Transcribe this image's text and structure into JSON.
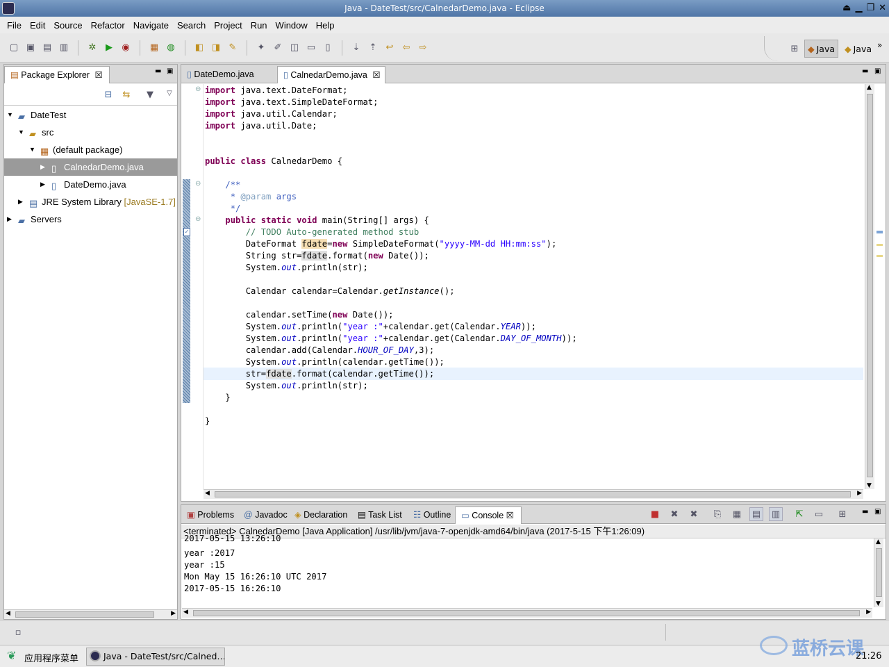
{
  "window": {
    "title": "Java - DateTest/src/CalnedarDemo.java - Eclipse"
  },
  "menu": [
    "File",
    "Edit",
    "Source",
    "Refactor",
    "Navigate",
    "Search",
    "Project",
    "Run",
    "Window",
    "Help"
  ],
  "perspectives": {
    "first": "Java",
    "second": "Java"
  },
  "explorer": {
    "tab_label": "Package Explorer",
    "items": [
      {
        "label": "DateTest",
        "icon": "project-icon"
      },
      {
        "label": "src",
        "icon": "source-folder-icon"
      },
      {
        "label": "(default package)",
        "icon": "package-icon"
      },
      {
        "label": "CalnedarDemo.java",
        "icon": "java-file-icon"
      },
      {
        "label": "DateDemo.java",
        "icon": "java-file-icon"
      },
      {
        "label": "JRE System Library",
        "suffix": "[JavaSE-1.7]",
        "icon": "library-icon"
      },
      {
        "label": "Servers",
        "icon": "folder-icon"
      }
    ]
  },
  "editor": {
    "tabs": [
      "DateDemo.java",
      "CalnedarDemo.java"
    ]
  },
  "bottom": {
    "tabs": [
      "Problems",
      "Javadoc",
      "Declaration",
      "Task List",
      "Outline",
      "Console"
    ],
    "header": "<terminated> CalnedarDemo [Java Application] /usr/lib/jvm/java-7-openjdk-amd64/bin/java (2017-5-15 下午1:26:09)",
    "output": [
      "2017-05-15 13:26:10",
      "year :2017",
      "year :15",
      "Mon May 15 16:26:10 UTC 2017",
      "2017-05-15 16:26:10"
    ]
  },
  "taskbar": {
    "start": "应用程序菜单",
    "window": "Java - DateTest/src/Calned…",
    "watermark": "蓝桥云课",
    "clock": "21:26"
  }
}
